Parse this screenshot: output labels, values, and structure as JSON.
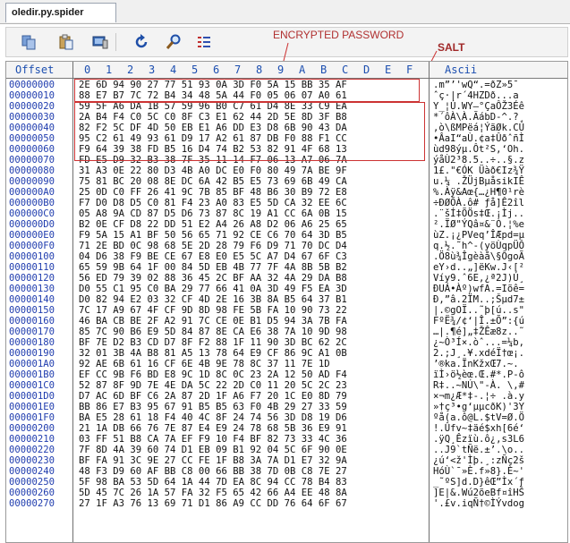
{
  "tab": {
    "label": "oledir.py.spider"
  },
  "toolbar": {
    "icons": [
      "copy-icon",
      "paste-icon",
      "monitor-icon",
      "refresh-icon",
      "search-icon",
      "list-icon"
    ]
  },
  "annotations": {
    "encrypted_password": "ENCRYPTED PASSWORD",
    "salt": "SALT"
  },
  "header": {
    "offset": "Offset",
    "columns": [
      "0",
      "1",
      "2",
      "3",
      "4",
      "5",
      "6",
      "7",
      "8",
      "9",
      "A",
      "B",
      "C",
      "D",
      "E",
      "F"
    ],
    "ascii": "Ascii"
  },
  "rows": [
    {
      "offset": "00000000",
      "hex": "2E 6D 94 90 27 77 51 93 0A 3D F0 5A 15 BB 35 AF",
      "ascii": ".m”’'wQ“.=ðZ»5¯"
    },
    {
      "offset": "00000010",
      "hex": "88 E7 B7 7C 72 B4 34 48 5A 44 F0 05 06 07 A0 61",
      "ascii": "ˆç·|r´4HZDð...a"
    },
    {
      "offset": "00000020",
      "hex": "59 5F A6 DA 1B 57 59 96 B0 C7 61 D4 8E 33 C9 EA",
      "ascii": "Y_¦Ú.WY–°ÇaÔŽ3Éê"
    },
    {
      "offset": "00000030",
      "hex": "2A B4 F4 C0 5C C0 8F C3 E1 62 44 2D 5E 8D 3F B8",
      "ascii": "*´ôÀ\\À.ÃábD-^.?¸"
    },
    {
      "offset": "00000040",
      "hex": "82 F2 5C DF 4D 50 EB E1 A6 DD E3 D8 6B 90 43 DA",
      "ascii": "‚ò\\ßMPëá¦ÝãØk.CÚ"
    },
    {
      "offset": "00000050",
      "hex": "95 C2 61 49 93 61 D9 17 A2 61 87 DB F0 88 F1 CC",
      "ascii": "•ÂaI“aÙ.¢a‡ÛðˆñÌ"
    },
    {
      "offset": "00000060",
      "hex": "F9 64 39 38 FD B5 16 D4 74 B2 53 82 91 4F 68 13",
      "ascii": "ùd98ýµ.Ôt²S‚‘Oh."
    },
    {
      "offset": "00000070",
      "hex": "FD E5 D9 32 B3 38 7F 35 11 14 F7 06 13 A7 06 7A",
      "ascii": "ýåÙ2³8.5..÷..§.z"
    },
    {
      "offset": "00000080",
      "hex": "31 A3 0E 22 80 D3 4B A0 DC E0 F0 80 49 7A BE 9F",
      "ascii": "1£.\"€ÓK Üàð€Iz¾Ÿ"
    },
    {
      "offset": "00000090",
      "hex": "75 81 BC 20 08 8E DC 6A 42 B5 E5 73 69 6B 49 CA",
      "ascii": "u.¼ .ŽÜjBµåsikIÊ"
    },
    {
      "offset": "000000A0",
      "hex": "25 0D C0 FF 26 41 9C 7B 85 BF 48 B6 30 B9 72 E8",
      "ascii": "%.Àÿ&Aœ{…¿H¶0¹rè"
    },
    {
      "offset": "000000B0",
      "hex": "F7 D0 D8 D5 C0 81 F4 23 A0 83 E5 5D CA 32 EE 6C",
      "ascii": "÷ÐØÕÀ.ô# ƒå]Ê2îl"
    },
    {
      "offset": "000000C0",
      "hex": "05 A8 9A CD 87 D5 D6 73 87 8C 19 A1 CC 6A 0B 15",
      "ascii": ".¨šÍ‡ÕÖs‡Œ.¡Ìj.."
    },
    {
      "offset": "000000D0",
      "hex": "B2 0E CF D8 22 DD 51 E2 A4 26 A8 D2 06 A6 25 65",
      "ascii": "².ÏØ\"ÝQâ¤&¨Ò.¦%e"
    },
    {
      "offset": "000000E0",
      "hex": "F9 5A 15 A1 BF 50 56 65 71 92 CE C6 70 64 3D B5",
      "ascii": "ùZ.¡¿PVeq’ÎÆpd=µ"
    },
    {
      "offset": "000000F0",
      "hex": "71 2E BD 0C 98 68 5E 2D 28 79 F6 D9 71 70 DC D4",
      "ascii": "q.½.˜h^-(yöÙqpÜÔ"
    },
    {
      "offset": "00000100",
      "hex": "04 D6 38 F9 BE CE 67 E8 E0 E5 5C A7 D4 67 6F C3",
      "ascii": ".Ö8ù¾Îgèàå\\§ÔgoÃ"
    },
    {
      "offset": "00000110",
      "hex": "65 59 9B 64 1F 00 84 5D EB 4B 77 7F 4A 8B 5B B2",
      "ascii": "eY›d..„]ëKw.J‹[²"
    },
    {
      "offset": "00000120",
      "hex": "56 ED 79 39 02 88 36 45 2C BF AA 32 4A 29 DA B8",
      "ascii": "Víy9.ˆ6E,¿ª2J)Ú¸"
    },
    {
      "offset": "00000130",
      "hex": "D0 55 C1 95 C0 BA 29 77 66 41 0A 3D 49 F5 EA 3D",
      "ascii": "ÐUÁ•Àº)wfA.=Iõê="
    },
    {
      "offset": "00000140",
      "hex": "D0 82 94 E2 03 32 CF 4D 2E 16 3B 8A B5 64 37 B1",
      "ascii": "Ð‚”â.2ÏM..;Šµd7±"
    },
    {
      "offset": "00000150",
      "hex": "7C 17 A9 67 4F CF 9D 8D 98 FE 5B FA 10 90 73 22",
      "ascii": "|.©gOÏ..˜þ[ú..s\""
    },
    {
      "offset": "00000160",
      "hex": "46 BA CB BE 2F A2 91 7C CE 0E B1 D5 94 3A 7B FA",
      "ascii": "FºË¾/¢‘|Î.±Õ”:{ú"
    },
    {
      "offset": "00000170",
      "hex": "85 7C 90 B6 E9 5D 84 87 8E CA E6 38 7A 10 9D 98",
      "ascii": "…|.¶é]„‡ŽÊæ8z..˜"
    },
    {
      "offset": "00000180",
      "hex": "BF 7E D2 B3 CD D7 8F F2 88 1F 11 90 3D BC 62 2C",
      "ascii": "¿~Ò³Í×.òˆ...=¼b,"
    },
    {
      "offset": "00000190",
      "hex": "32 01 3B 4A B8 81 A5 13 78 64 E9 CF 86 9C A1 0B",
      "ascii": "2.;J¸.¥.xdéÏ†œ¡."
    },
    {
      "offset": "000001A0",
      "hex": "92 AE 6B 61 16 CF 6E 4B 9E 78 8C 37 11 7E 1D",
      "ascii": "’®ka.ÏnKžxŒ7.~."
    },
    {
      "offset": "000001B0",
      "hex": "EF CC 9B F6 BD E8 9C 1D 8C 0C 23 2A 12 50 AD F4",
      "ascii": "ïÌ›ö½èœ.Œ.#*.P-ô"
    },
    {
      "offset": "000001C0",
      "hex": "52 87 8F 9D 7E 4E DA 5C 22 2D C0 11 20 5C 2C 23",
      "ascii": "R‡..~NÚ\\\"-À. \\,#"
    },
    {
      "offset": "000001D0",
      "hex": "D7 AC 6D BF C6 2A 87 2D 1F A6 F7 20 1C E0 8D 79",
      "ascii": "×¬m¿Æ*‡-.¦÷ .à.y"
    },
    {
      "offset": "000001E0",
      "hex": "BB 86 E7 B3 95 67 91 B5 B5 63 F0 4B 29 27 33 59",
      "ascii": "»†ç³•g‘µµcðK)'3Y"
    },
    {
      "offset": "000001F0",
      "hex": "BA E5 28 61 18 F4 40 4C 8F 24 74 56 3D D8 19 D6",
      "ascii": "ºå(a.ô@L.$tV=Ø.Ö"
    },
    {
      "offset": "00000200",
      "hex": "21 1A DB 66 76 7E 87 E4 E9 24 78 68 5B 36 E9 91",
      "ascii": "!.Ûfv~‡äé$xh[6é‘"
    },
    {
      "offset": "00000210",
      "hex": "03 FF 51 B8 CA 7A EF F9 10 F4 BF 82 73 33 4C 36",
      "ascii": ".ÿQ¸Êzïù.ô¿‚s3L6"
    },
    {
      "offset": "00000220",
      "hex": "7F 8D 4A 39 60 74 D1 EB 09 B1 92 04 5C 6F 90 0E",
      "ascii": "..J9`tÑë.±’.\\o.."
    },
    {
      "offset": "00000230",
      "hex": "BF FA 91 3C 9E 27 CC FE 1F B8 3A 7A D1 E7 32 9A",
      "ascii": "¿ú‘<ž'Ìþ.¸:zÑç2š"
    },
    {
      "offset": "00000240",
      "hex": "48 F3 D9 60 AF BB C8 00 66 BB 38 7D 0B C8 7E 27",
      "ascii": "HóÙ`¯»È.f»8}.È~'"
    },
    {
      "offset": "00000250",
      "hex": "5F 98 BA 53 5D 64 1A 44 7D EA 8C 94 CC 78 B4 83",
      "ascii": "_˜ºS]d.D}êŒ”Ìx´ƒ"
    },
    {
      "offset": "00000260",
      "hex": "5D 45 7C 26 1A 57 FA 32 F5 65 42 66 A4 EE 48 8A",
      "ascii": "]E|&.Wú2õeBf¤îHŠ"
    },
    {
      "offset": "00000270",
      "hex": "27 1F A3 76 13 69 71 D1 86 A9 CC DD 76 64 6F 67",
      "ascii": "'.£v.iqÑ†©ÌÝvdog"
    }
  ]
}
